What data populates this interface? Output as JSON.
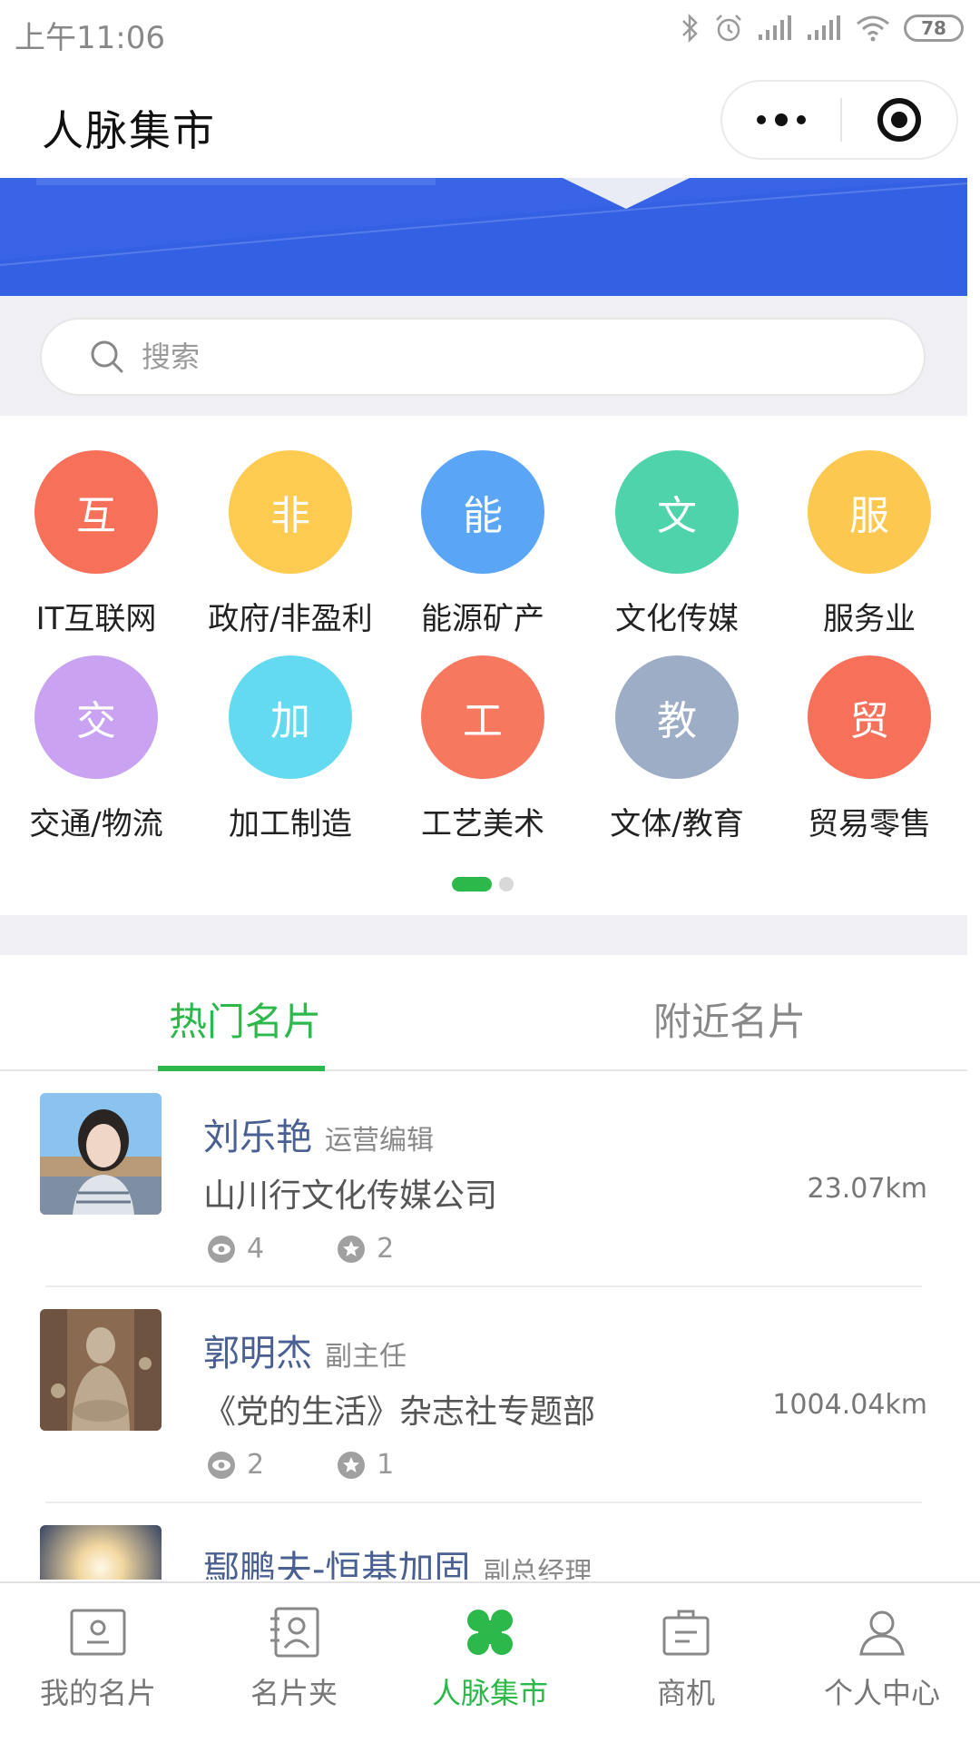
{
  "status_bar": {
    "time": "上午11:06",
    "battery": "78"
  },
  "title_bar": {
    "title": "人脉集市"
  },
  "search": {
    "placeholder": "搜索"
  },
  "categories": [
    {
      "char": "互",
      "label": "IT互联网",
      "color": "#f6705a"
    },
    {
      "char": "非",
      "label": "政府/非盈利",
      "color": "#fccb4f"
    },
    {
      "char": "能",
      "label": "能源矿产",
      "color": "#5aa5f5"
    },
    {
      "char": "文",
      "label": "文化传媒",
      "color": "#4fd3aa"
    },
    {
      "char": "服",
      "label": "服务业",
      "color": "#fcc84f"
    },
    {
      "char": "交",
      "label": "交通/物流",
      "color": "#c9a2f2"
    },
    {
      "char": "加",
      "label": "加工制造",
      "color": "#63daf0"
    },
    {
      "char": "工",
      "label": "工艺美术",
      "color": "#f6785e"
    },
    {
      "char": "教",
      "label": "文体/教育",
      "color": "#9eadc6"
    },
    {
      "char": "贸",
      "label": "贸易零售",
      "color": "#f6705a"
    }
  ],
  "tabs": {
    "hot": "热门名片",
    "nearby": "附近名片"
  },
  "cards": [
    {
      "name": "刘乐艳",
      "role": "运营编辑",
      "company": "山川行文化传媒公司",
      "distance": "23.07km",
      "views": "4",
      "stars": "2"
    },
    {
      "name": "郭明杰",
      "role": "副主任",
      "company": "《党的生活》杂志社专题部",
      "distance": "1004.04km",
      "views": "2",
      "stars": "1"
    },
    {
      "name": "鄢鹏夫-恒基加固",
      "role": "副总经理"
    }
  ],
  "bottom_nav": {
    "my_card": "我的名片",
    "card_holder": "名片夹",
    "market": "人脉集市",
    "business": "商机",
    "personal": "个人中心"
  },
  "colors": {
    "accent": "#2db84b",
    "banner": "#3a64e8",
    "name_text": "#4a5f92"
  }
}
